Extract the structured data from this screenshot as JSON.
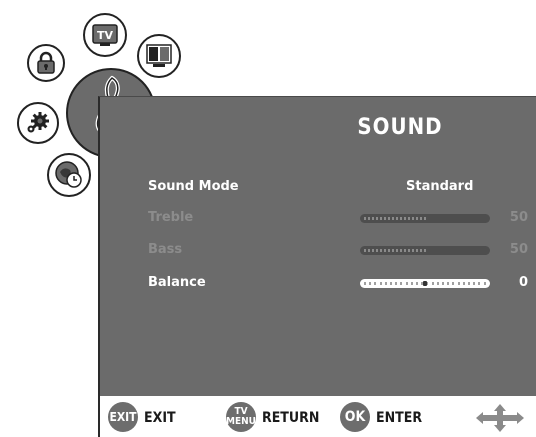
{
  "menu": {
    "title": "SOUND",
    "items": [
      {
        "label": "Sound Mode",
        "value": "Standard",
        "state": "active"
      },
      {
        "label": "Treble",
        "value": "50",
        "level": 0.5,
        "state": "disabled"
      },
      {
        "label": "Bass",
        "value": "50",
        "level": 0.5,
        "state": "disabled"
      },
      {
        "label": "Balance",
        "value": "0",
        "level": 0.5,
        "state": "active"
      }
    ]
  },
  "footer": {
    "exit_key": "EXIT",
    "exit_label": "EXIT",
    "menu_key_top": "TV",
    "menu_key_bottom": "MENU",
    "return_label": "RETURN",
    "ok_key": "OK",
    "enter_label": "ENTER"
  },
  "icons": {
    "tv_icon_text": "TV",
    "categories": [
      "lock-icon",
      "tv-icon",
      "picture-icon",
      "sound-icon",
      "settings-icon",
      "timer-icon"
    ]
  },
  "colors": {
    "panel": "#6b6b6b",
    "active_text": "#ffffff",
    "disabled_text": "#8c8c8c"
  }
}
